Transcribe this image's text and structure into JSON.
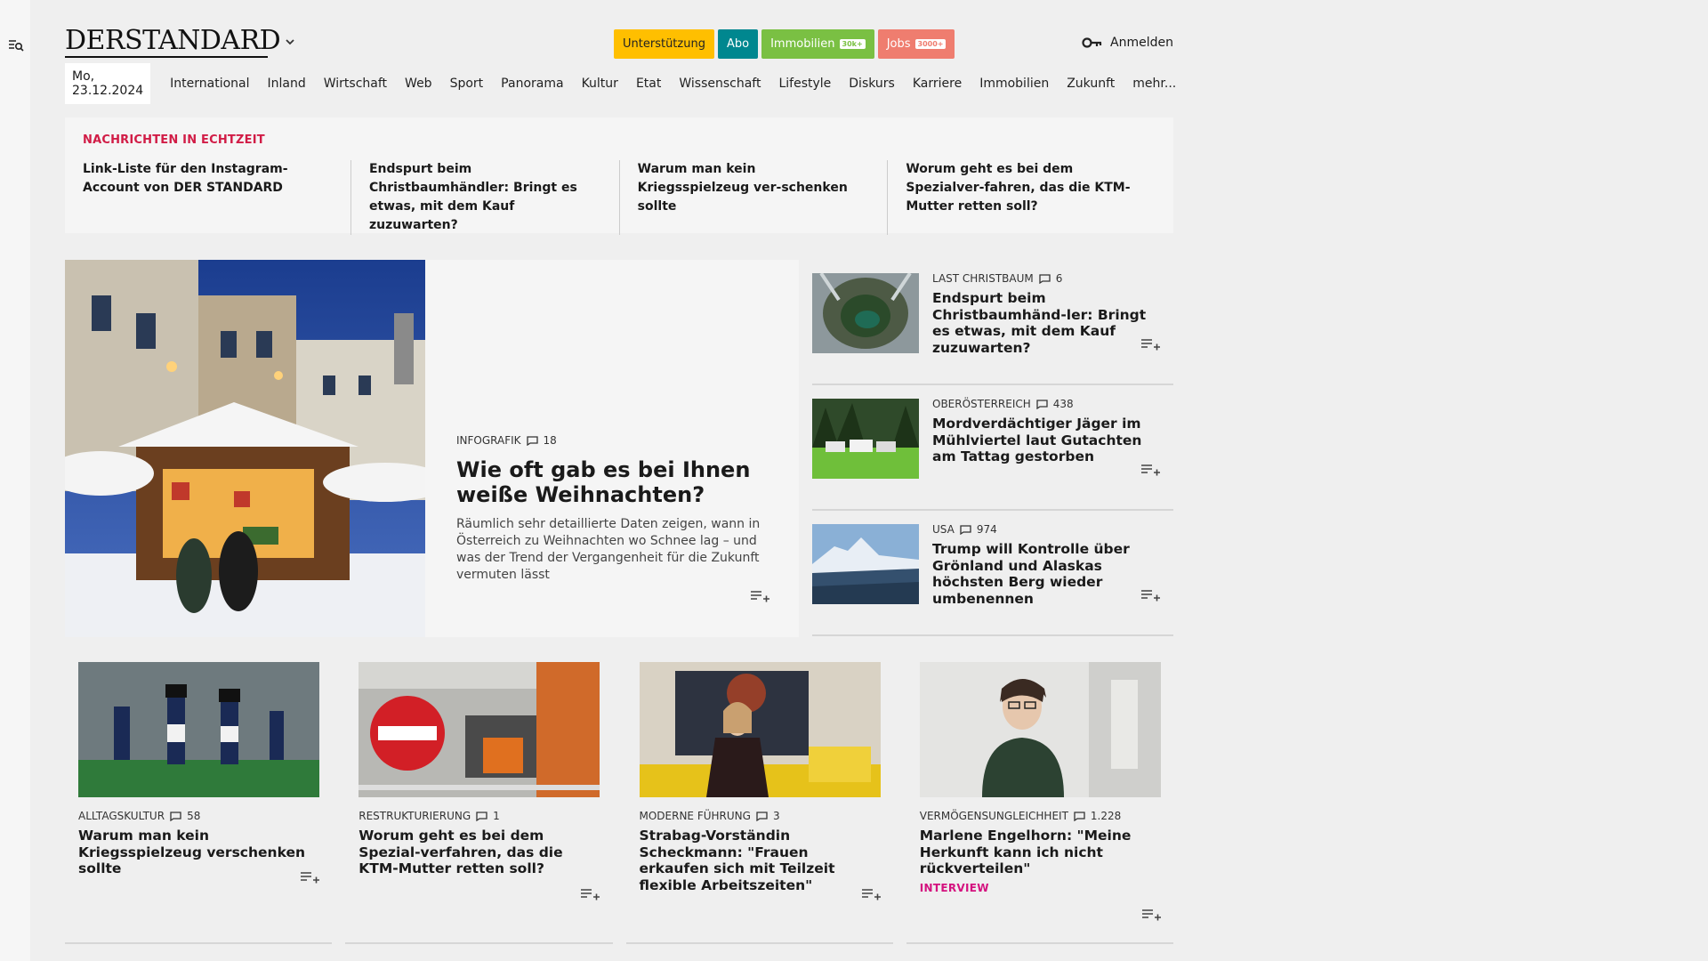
{
  "header": {
    "logo": "DERSTANDARD",
    "pills": {
      "support": "Unterstützung",
      "abo": "Abo",
      "immo": "Immobilien",
      "immo_badge": "30k+",
      "jobs": "Jobs",
      "jobs_badge": "3000+"
    },
    "login": "Anmelden"
  },
  "nav": {
    "date": "Mo, 23.12.2024",
    "items": [
      "International",
      "Inland",
      "Wirtschaft",
      "Web",
      "Sport",
      "Panorama",
      "Kultur",
      "Etat",
      "Wissenschaft",
      "Lifestyle",
      "Diskurs",
      "Karriere",
      "Immobilien",
      "Zukunft",
      "mehr..."
    ]
  },
  "ticker": {
    "title": "NACHRICHTEN IN ECHTZEIT",
    "items": [
      "Link-Liste für den Instagram-Account von DER STANDARD",
      "Endspurt beim Christbaumhändler: Bringt es etwas, mit dem Kauf zuzuwarten?",
      "Warum man kein Kriegsspielzeug ver-schenken sollte",
      "Worum geht es bei dem Spezialver-fahren, das die KTM-Mutter retten soll?"
    ]
  },
  "hero": {
    "kicker": "INFOGRAFIK",
    "comments": "18",
    "title": "Wie oft gab es bei Ihnen weiße Weihnachten?",
    "desc": "Räumlich sehr detaillierte Daten zeigen, wann in Österreich zu Weihnachten wo Schnee lag – und was der Trend der Vergangenheit für die Zukunft vermuten lässt"
  },
  "side": [
    {
      "kicker": "LAST CHRISTBAUM",
      "comments": "6",
      "title": "Endspurt beim Christbaumhänd-ler: Bringt es etwas, mit dem Kauf zuzuwarten?"
    },
    {
      "kicker": "OBERÖSTERREICH",
      "comments": "438",
      "title": "Mordverdächtiger Jäger im Mühlviertel laut Gutachten am Tattag gestorben"
    },
    {
      "kicker": "USA",
      "comments": "974",
      "title": "Trump will Kontrolle über Grönland und Alaskas höchsten Berg wieder umbenennen"
    }
  ],
  "cards": [
    {
      "kicker": "ALLTAGSKULTUR",
      "comments": "58",
      "title": "Warum man kein Kriegsspielzeug verschenken sollte"
    },
    {
      "kicker": "RESTRUKTURIERUNG",
      "comments": "1",
      "title": "Worum geht es bei dem Spezial-verfahren, das die KTM-Mutter retten soll?"
    },
    {
      "kicker": "MODERNE FÜHRUNG",
      "comments": "3",
      "title": "Strabag-Vorständin Scheckmann: \"Frauen erkaufen sich mit Teilzeit flexible Arbeitszeiten\""
    },
    {
      "kicker": "VERMÖGENSUNGLEICHHEIT",
      "comments": "1.228",
      "title": "Marlene Engelhorn: \"Meine Herkunft kann ich nicht rückverteilen\"",
      "tag": "INTERVIEW"
    }
  ]
}
